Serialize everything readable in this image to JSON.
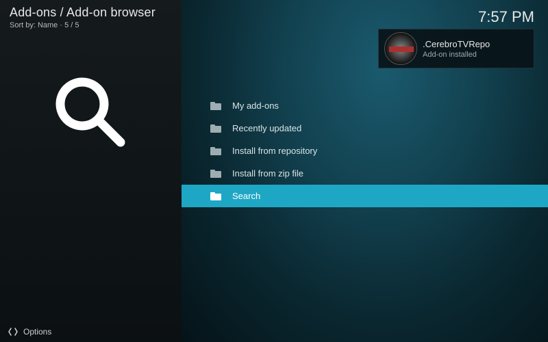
{
  "header": {
    "breadcrumb": "Add-ons / Add-on browser",
    "sort_label": "Sort by: Name",
    "position": "5 / 5"
  },
  "clock": "7:57 PM",
  "notification": {
    "title": ".CerebroTVRepo",
    "subtitle": "Add-on installed"
  },
  "menu": {
    "items": [
      {
        "label": "My add-ons",
        "selected": false
      },
      {
        "label": "Recently updated",
        "selected": false
      },
      {
        "label": "Install from repository",
        "selected": false
      },
      {
        "label": "Install from zip file",
        "selected": false
      },
      {
        "label": "Search",
        "selected": true
      }
    ]
  },
  "footer": {
    "options_label": "Options"
  }
}
